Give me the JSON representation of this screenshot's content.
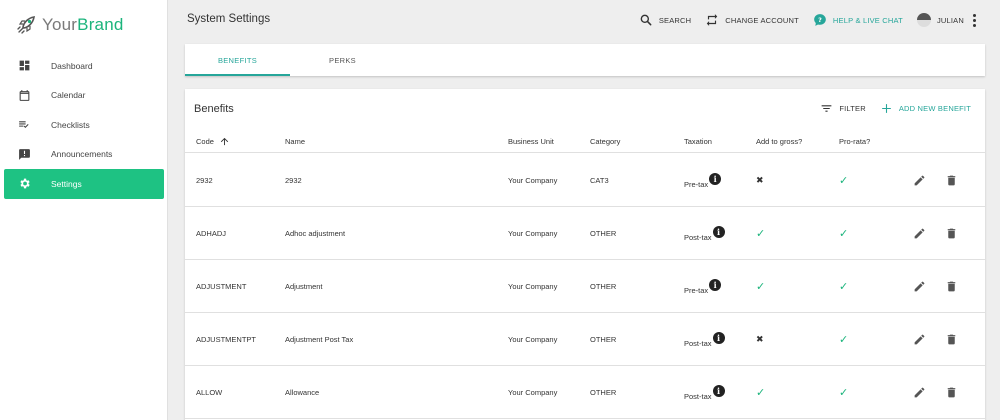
{
  "brand": {
    "your": "Your",
    "brand": "Brand",
    "accent": "#1bb47c"
  },
  "sidebar": {
    "active_color": "#1ec283",
    "items": [
      {
        "label": "Dashboard",
        "icon": "dashboard-icon"
      },
      {
        "label": "Calendar",
        "icon": "calendar-icon"
      },
      {
        "label": "Checklists",
        "icon": "checklist-icon"
      },
      {
        "label": "Announcements",
        "icon": "announcement-icon"
      },
      {
        "label": "Settings",
        "icon": "gear-icon",
        "active": true
      }
    ]
  },
  "header": {
    "title": "System Settings",
    "search_label": "SEARCH",
    "change_account_label": "CHANGE ACCOUNT",
    "help_label": "HELP & LIVE CHAT",
    "user_name": "JULIAN"
  },
  "tabs": [
    {
      "label": "BENEFITS",
      "active": true
    },
    {
      "label": "PERKS",
      "active": false
    }
  ],
  "card": {
    "title": "Benefits",
    "filter_label": "FILTER",
    "add_label": "ADD NEW BENEFIT"
  },
  "table": {
    "headers": {
      "code": "Code",
      "name": "Name",
      "business_unit": "Business Unit",
      "category": "Category",
      "taxation": "Taxation",
      "add_to_gross": "Add to gross?",
      "pro_rata": "Pro-rata?"
    },
    "symbols": {
      "check": "✓",
      "cross": "✖",
      "info": "i"
    },
    "rows": [
      {
        "code": "2932",
        "name": "2932",
        "business_unit": "Your Company",
        "category": "CAT3",
        "taxation": "Pre-tax",
        "add_to_gross": false,
        "pro_rata": true
      },
      {
        "code": "ADHADJ",
        "name": "Adhoc adjustment",
        "business_unit": "Your Company",
        "category": "OTHER",
        "taxation": "Post-tax",
        "add_to_gross": true,
        "pro_rata": true
      },
      {
        "code": "ADJUSTMENT",
        "name": "Adjustment",
        "business_unit": "Your Company",
        "category": "OTHER",
        "taxation": "Pre-tax",
        "add_to_gross": true,
        "pro_rata": true
      },
      {
        "code": "ADJUSTMENTPT",
        "name": "Adjustment Post Tax",
        "business_unit": "Your Company",
        "category": "OTHER",
        "taxation": "Post-tax",
        "add_to_gross": false,
        "pro_rata": true
      },
      {
        "code": "ALLOW",
        "name": "Allowance",
        "business_unit": "Your Company",
        "category": "OTHER",
        "taxation": "Post-tax",
        "add_to_gross": true,
        "pro_rata": true
      }
    ]
  }
}
